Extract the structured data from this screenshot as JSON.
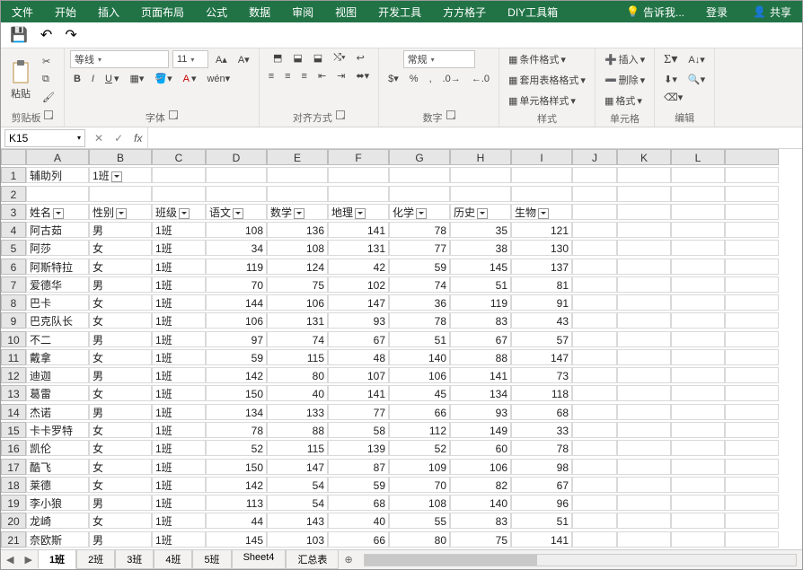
{
  "tabs": {
    "file": "文件",
    "home": "开始",
    "insert": "插入",
    "pageLayout": "页面布局",
    "formulas": "公式",
    "data": "数据",
    "review": "审阅",
    "view": "视图",
    "dev": "开发工具",
    "fanggz": "方方格子",
    "diy": "DIY工具箱",
    "tellme": "告诉我...",
    "signin": "登录",
    "share": "共享"
  },
  "groups": {
    "clipboard": "剪贴板",
    "font": "字体",
    "alignment": "对齐方式",
    "number": "数字",
    "styles": "样式",
    "cells": "单元格",
    "editing": "编辑"
  },
  "clipboard": {
    "paste": "粘贴"
  },
  "font": {
    "name": "等线",
    "size": "11"
  },
  "number": {
    "format": "常规"
  },
  "styles": {
    "cond": "条件格式",
    "table": "套用表格格式",
    "cell": "单元格样式"
  },
  "cells": {
    "insert": "插入",
    "delete": "删除",
    "format": "格式"
  },
  "nameBox": "K15",
  "filterRow": {
    "a": "辅助列",
    "b": "1班"
  },
  "headers": [
    "姓名",
    "性别",
    "班级",
    "语文",
    "数学",
    "地理",
    "化学",
    "历史",
    "生物"
  ],
  "rows": [
    {
      "n": "阿古茹",
      "s": "男",
      "c": "1班",
      "v": [
        108,
        136,
        141,
        78,
        35,
        121
      ]
    },
    {
      "n": "阿莎",
      "s": "女",
      "c": "1班",
      "v": [
        34,
        108,
        131,
        77,
        38,
        130
      ]
    },
    {
      "n": "阿斯特拉",
      "s": "女",
      "c": "1班",
      "v": [
        119,
        124,
        42,
        59,
        145,
        137
      ]
    },
    {
      "n": "爱德华",
      "s": "男",
      "c": "1班",
      "v": [
        70,
        75,
        102,
        74,
        51,
        81
      ]
    },
    {
      "n": "巴卡",
      "s": "女",
      "c": "1班",
      "v": [
        144,
        106,
        147,
        36,
        119,
        91
      ]
    },
    {
      "n": "巴克队长",
      "s": "女",
      "c": "1班",
      "v": [
        106,
        131,
        93,
        78,
        83,
        43
      ]
    },
    {
      "n": "不二",
      "s": "男",
      "c": "1班",
      "v": [
        97,
        74,
        67,
        51,
        67,
        57
      ]
    },
    {
      "n": "戴拿",
      "s": "女",
      "c": "1班",
      "v": [
        59,
        115,
        48,
        140,
        88,
        147
      ]
    },
    {
      "n": "迪迦",
      "s": "男",
      "c": "1班",
      "v": [
        142,
        80,
        107,
        106,
        141,
        73
      ]
    },
    {
      "n": "葛雷",
      "s": "女",
      "c": "1班",
      "v": [
        150,
        40,
        141,
        45,
        134,
        118
      ]
    },
    {
      "n": "杰诺",
      "s": "男",
      "c": "1班",
      "v": [
        134,
        133,
        77,
        66,
        93,
        68
      ]
    },
    {
      "n": "卡卡罗特",
      "s": "女",
      "c": "1班",
      "v": [
        78,
        88,
        58,
        112,
        149,
        33
      ]
    },
    {
      "n": "凯伦",
      "s": "女",
      "c": "1班",
      "v": [
        52,
        115,
        139,
        52,
        60,
        78
      ]
    },
    {
      "n": "酷飞",
      "s": "女",
      "c": "1班",
      "v": [
        150,
        147,
        87,
        109,
        106,
        98
      ]
    },
    {
      "n": "莱德",
      "s": "女",
      "c": "1班",
      "v": [
        142,
        54,
        59,
        70,
        82,
        67
      ]
    },
    {
      "n": "李小狼",
      "s": "男",
      "c": "1班",
      "v": [
        113,
        54,
        68,
        108,
        140,
        96
      ]
    },
    {
      "n": "龙崎",
      "s": "女",
      "c": "1班",
      "v": [
        44,
        143,
        40,
        55,
        83,
        51
      ]
    },
    {
      "n": "奈欧斯",
      "s": "男",
      "c": "1班",
      "v": [
        145,
        103,
        66,
        80,
        75,
        141
      ]
    }
  ],
  "cols": [
    "A",
    "B",
    "C",
    "D",
    "E",
    "F",
    "G",
    "H",
    "I",
    "J",
    "K",
    "L"
  ],
  "sheets": [
    "1班",
    "2班",
    "3班",
    "4班",
    "5班",
    "Sheet4",
    "汇总表"
  ],
  "activeSheet": "1班"
}
